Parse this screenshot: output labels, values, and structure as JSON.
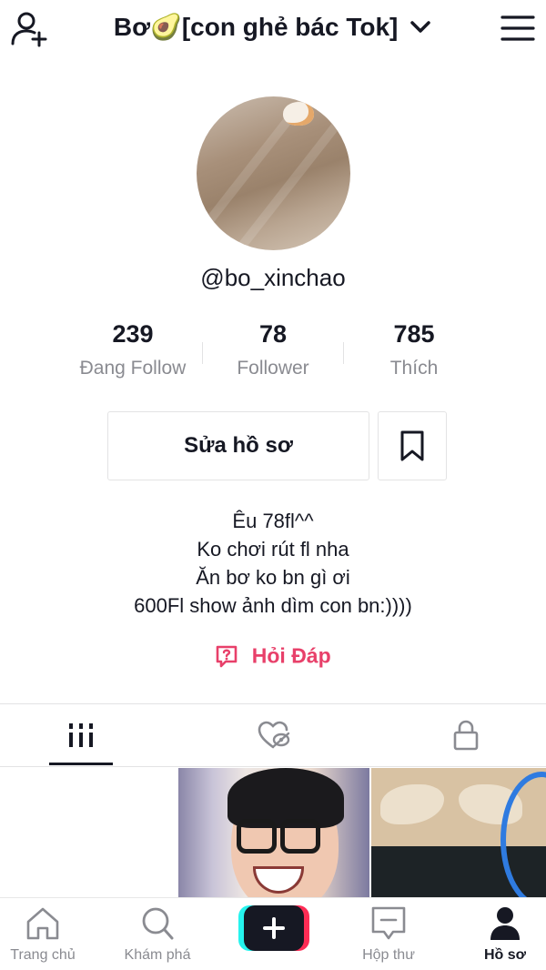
{
  "header": {
    "title": "Bơ🥑[con ghẻ bác Tok]",
    "add_user_icon": "add-user-icon",
    "chevron_icon": "chevron-down-icon",
    "menu_icon": "hamburger-menu-icon"
  },
  "profile": {
    "username": "@bo_xinchao"
  },
  "stats": [
    {
      "value": "239",
      "label": "Đang Follow"
    },
    {
      "value": "78",
      "label": "Follower"
    },
    {
      "value": "785",
      "label": "Thích"
    }
  ],
  "actions": {
    "edit_label": "Sửa hồ sơ",
    "bookmark_icon": "bookmark-icon"
  },
  "bio": {
    "lines": [
      "Êu 78fl^^",
      "Ko chơi rút fl nha",
      "Ăn bơ ko bn gì ơi",
      "600Fl show ảnh dìm con bn:))))"
    ]
  },
  "qa": {
    "label": "Hỏi Đáp",
    "color": "#e8406a"
  },
  "tabs": [
    {
      "icon": "videos-grid-icon",
      "active": true
    },
    {
      "icon": "liked-hidden-icon",
      "active": false
    },
    {
      "icon": "lock-icon",
      "active": false
    }
  ],
  "bottom_nav": {
    "items": [
      {
        "label": "Trang chủ",
        "icon": "home-icon"
      },
      {
        "label": "Khám phá",
        "icon": "search-icon"
      },
      {
        "label": "",
        "icon": "plus-icon"
      },
      {
        "label": "Hộp thư",
        "icon": "inbox-icon"
      },
      {
        "label": "Hồ sơ",
        "icon": "profile-icon",
        "active": true
      }
    ]
  },
  "colors": {
    "text": "#161823",
    "muted": "#8a8b91",
    "accent": "#fe2c55",
    "accent2": "#25f4ee"
  }
}
